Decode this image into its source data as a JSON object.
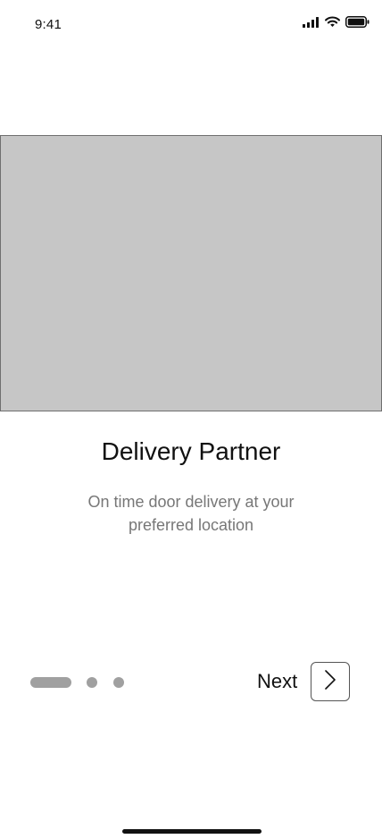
{
  "status_bar": {
    "time": "9:41",
    "icons": [
      "signal-icon",
      "wifi-icon",
      "battery-icon"
    ]
  },
  "onboarding": {
    "title": "Delivery Partner",
    "subtitle": "On time door delivery at your preferred location",
    "pagination": {
      "total_pages": 3,
      "current_page": 1
    },
    "next_label": "Next",
    "next_icon": "chevron-right-icon"
  },
  "colors": {
    "placeholder_fill": "#c6c6c6",
    "indicator": "#a0a0a0",
    "subtitle_text": "#777777"
  }
}
